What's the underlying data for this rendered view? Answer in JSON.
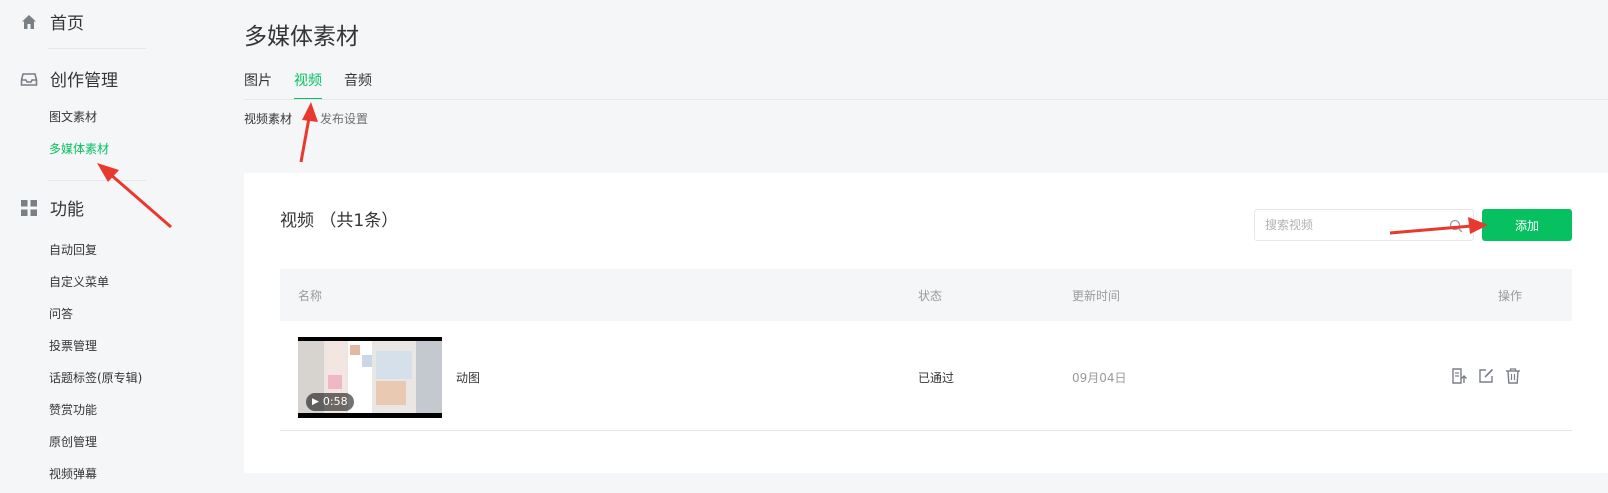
{
  "sidebar": {
    "home_label": "首页",
    "groups": [
      {
        "label": "创作管理",
        "icon": "inbox-icon",
        "items": [
          "图文素材",
          "多媒体素材"
        ]
      },
      {
        "label": "功能",
        "icon": "grid-icon",
        "items": [
          "自动回复",
          "自定义菜单",
          "问答",
          "投票管理",
          "话题标签(原专辑)",
          "赞赏功能",
          "原创管理",
          "视频弹幕"
        ]
      }
    ],
    "active_item": "多媒体素材"
  },
  "header": {
    "title": "多媒体素材"
  },
  "tabs": [
    {
      "label": "图片",
      "active": false
    },
    {
      "label": "视频",
      "active": true
    },
    {
      "label": "音频",
      "active": false
    }
  ],
  "subtabs": [
    "视频素材",
    "发布设置"
  ],
  "panel": {
    "title": "视频 （共1条）",
    "search_placeholder": "搜索视频",
    "add_label": "添加"
  },
  "table": {
    "columns": [
      "名称",
      "状态",
      "更新时间",
      "操作"
    ],
    "rows": [
      {
        "duration": "0:58",
        "name": "动图",
        "status": "已通过",
        "time": "09月04日"
      }
    ]
  },
  "colors": {
    "accent": "#07c160",
    "annotation": "#e8392f"
  }
}
